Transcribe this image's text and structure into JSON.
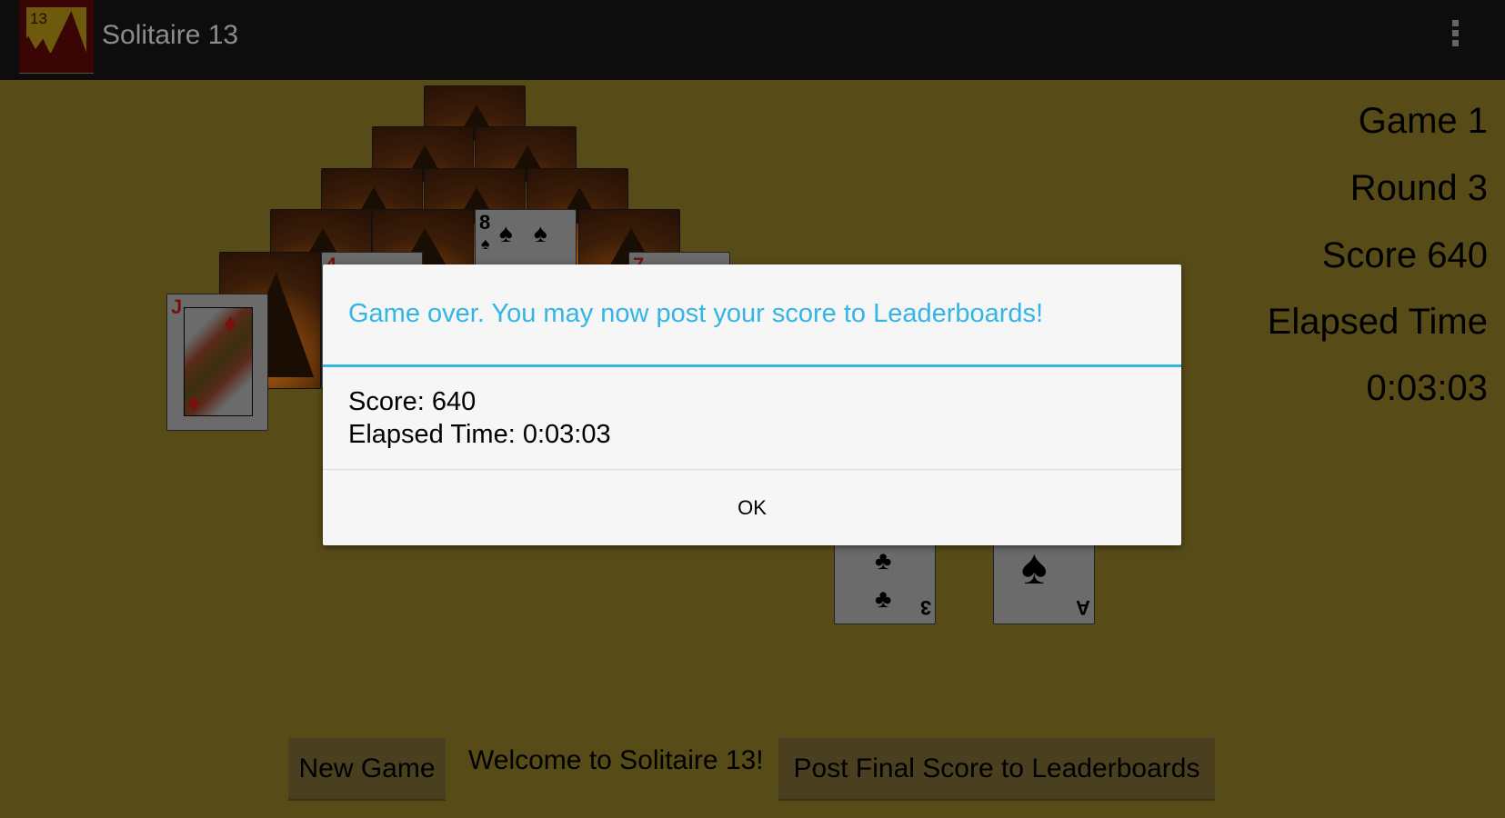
{
  "app": {
    "title": "Solitaire 13",
    "icon_number": "13",
    "icon": "app-logo-mountain",
    "menu_icon": "overflow-menu-icon"
  },
  "colors": {
    "felt": "#574c18",
    "accent": "#33b5e5",
    "topbar": "#0d0d0d"
  },
  "pyramid": {
    "face_cards": [
      {
        "rank": "8",
        "suit": "♠",
        "color": "black"
      },
      {
        "rank": "4",
        "suit": "",
        "color": "red"
      },
      {
        "rank": "7",
        "suit": "",
        "color": "red"
      }
    ]
  },
  "waste_card": {
    "rank": "J",
    "suit": "♦",
    "color": "red"
  },
  "bottom_cards": [
    {
      "rank": "3",
      "suit": "♣"
    },
    {
      "rank": "A",
      "suit": "♠"
    }
  ],
  "stats": {
    "game": "Game 1",
    "round": "Round 3",
    "score": "Score 640",
    "elapsed_label": "Elapsed Time",
    "elapsed_value": "0:03:03"
  },
  "buttons": {
    "new_game": "New Game",
    "post_score": "Post Final Score to Leaderboards"
  },
  "status": "Welcome to Solitaire 13!",
  "dialog": {
    "title": "Game over. You may now post your score to Leaderboards!",
    "score_line": "Score: 640",
    "time_line": "Elapsed Time: 0:03:03",
    "ok": "OK"
  }
}
